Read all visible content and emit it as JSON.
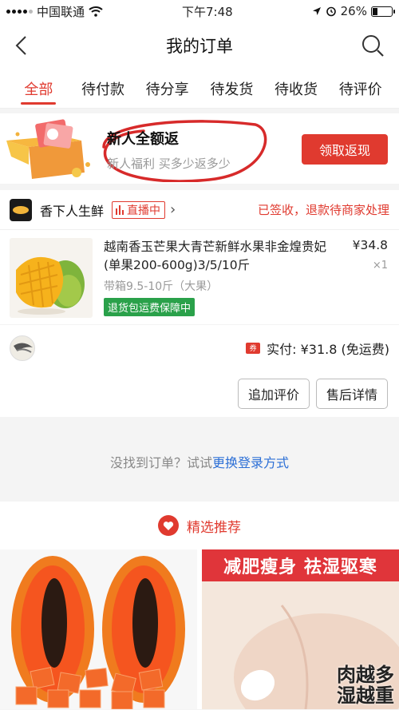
{
  "status_bar": {
    "carrier": "中国联通",
    "time": "下午7:48",
    "battery": "26%",
    "battery_level": 0.26
  },
  "nav": {
    "title": "我的订单"
  },
  "tabs": [
    {
      "label": "全部",
      "active": true
    },
    {
      "label": "待付款"
    },
    {
      "label": "待分享"
    },
    {
      "label": "待发货"
    },
    {
      "label": "待收货"
    },
    {
      "label": "待评价"
    }
  ],
  "promo": {
    "title": "新人全额返",
    "subtitle": "新人福利 买多少返多少",
    "button": "领取返现"
  },
  "order": {
    "shop_name": "香下人生鲜",
    "live_badge": "直播中",
    "status": "已签收，退款待商家处理",
    "item_title": "越南香玉芒果大青芒新鲜水果非金煌贵妃(单果200-600g)3/5/10斤",
    "item_spec": "带箱9.5-10斤（大果）",
    "guarantee": "退货包运费保障中",
    "price": "¥34.8",
    "quantity": "×1",
    "coupon_icon": "券",
    "paid_label": "实付: ¥31.8 (免运费)",
    "buttons": {
      "review": "追加评价",
      "after_sale": "售后详情"
    }
  },
  "not_found": {
    "text": "没找到订单？试试",
    "link": "更换登录方式"
  },
  "recommend": {
    "title": "精选推荐",
    "card2_banner": "减肥瘦身  祛湿驱寒",
    "card2_overlay": "肉越多\n湿越重"
  },
  "colors": {
    "accent": "#e03a2f",
    "link": "#2c6fd6",
    "guarantee": "#2aa14a"
  }
}
